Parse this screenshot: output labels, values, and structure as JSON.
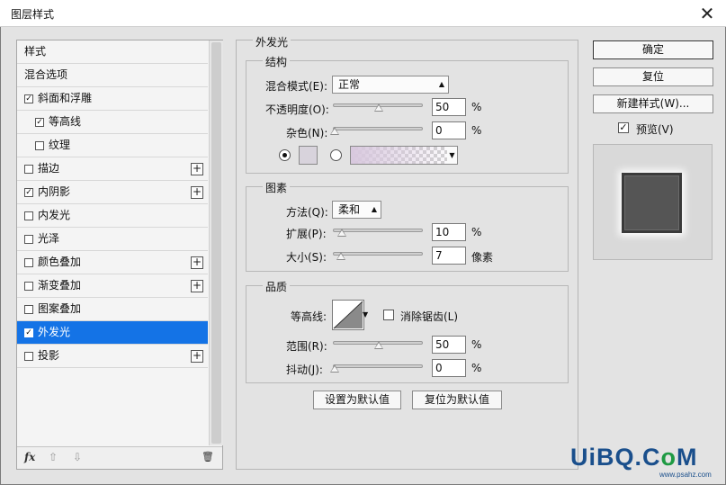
{
  "window": {
    "title": "图层样式",
    "close_glyph": "✕"
  },
  "styles_list": {
    "items": [
      {
        "label": "样式",
        "checkbox": false,
        "checked": false,
        "plus": false,
        "indent": 0
      },
      {
        "label": "混合选项",
        "checkbox": false,
        "checked": false,
        "plus": false,
        "indent": 0
      },
      {
        "label": "斜面和浮雕",
        "checkbox": true,
        "checked": true,
        "plus": false,
        "indent": 0
      },
      {
        "label": "等高线",
        "checkbox": true,
        "checked": true,
        "plus": false,
        "indent": 1
      },
      {
        "label": "纹理",
        "checkbox": true,
        "checked": false,
        "plus": false,
        "indent": 1
      },
      {
        "label": "描边",
        "checkbox": true,
        "checked": false,
        "plus": true,
        "indent": 0
      },
      {
        "label": "内阴影",
        "checkbox": true,
        "checked": true,
        "plus": true,
        "indent": 0
      },
      {
        "label": "内发光",
        "checkbox": true,
        "checked": false,
        "plus": false,
        "indent": 0
      },
      {
        "label": "光泽",
        "checkbox": true,
        "checked": false,
        "plus": false,
        "indent": 0
      },
      {
        "label": "颜色叠加",
        "checkbox": true,
        "checked": false,
        "plus": true,
        "indent": 0
      },
      {
        "label": "渐变叠加",
        "checkbox": true,
        "checked": false,
        "plus": true,
        "indent": 0
      },
      {
        "label": "图案叠加",
        "checkbox": true,
        "checked": false,
        "plus": false,
        "indent": 0
      },
      {
        "label": "外发光",
        "checkbox": true,
        "checked": true,
        "plus": false,
        "indent": 0,
        "selected": true
      },
      {
        "label": "投影",
        "checkbox": true,
        "checked": false,
        "plus": true,
        "indent": 0
      }
    ],
    "toolbar": {
      "fx": "fx",
      "up": "⇧",
      "down": "⇩",
      "trash": "🗑"
    }
  },
  "panel": {
    "title": "外发光",
    "structure": {
      "title": "结构",
      "blend_mode_label": "混合模式(E):",
      "blend_mode_value": "正常",
      "opacity_label": "不透明度(O):",
      "opacity_value": "50",
      "opacity_unit": "%",
      "noise_label": "杂色(N):",
      "noise_value": "0",
      "noise_unit": "%"
    },
    "elements": {
      "title": "图素",
      "technique_label": "方法(Q):",
      "technique_value": "柔和",
      "spread_label": "扩展(P):",
      "spread_value": "10",
      "spread_unit": "%",
      "size_label": "大小(S):",
      "size_value": "7",
      "size_unit": "像素"
    },
    "quality": {
      "title": "品质",
      "contour_label": "等高线:",
      "antialias_label": "消除锯齿(L)",
      "range_label": "范围(R):",
      "range_value": "50",
      "range_unit": "%",
      "jitter_label": "抖动(J):",
      "jitter_value": "0",
      "jitter_unit": "%"
    },
    "make_default": "设置为默认值",
    "reset_default": "复位为默认值"
  },
  "right": {
    "ok": "确定",
    "reset": "复位",
    "new_style": "新建样式(W)...",
    "preview_label": "预览(V)",
    "preview_checked": true
  },
  "watermark": {
    "text_a": "UiBQ.C",
    "text_o": "o",
    "text_b": "M",
    "sub": "www.psahz.com"
  },
  "colors": {
    "selection": "#1473e6",
    "dialog_bg": "#e3e3e3",
    "preview_fill": "#555555"
  }
}
